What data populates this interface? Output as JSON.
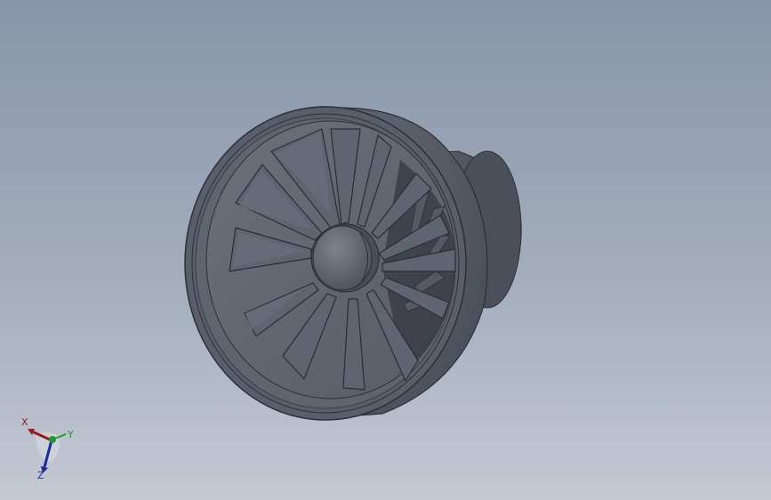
{
  "view": {
    "background_top": "#8796aa",
    "background_bottom": "#c4c9d3",
    "part_color": "#5d6270"
  },
  "model": {
    "name": "ducted-fan",
    "blade_count": 13
  },
  "triad": {
    "x_label": "X",
    "y_label": "Y",
    "z_label": "Z",
    "x_color": "#9b1b1b",
    "y_color": "#1b9b2a",
    "z_color": "#1b2b9b"
  }
}
